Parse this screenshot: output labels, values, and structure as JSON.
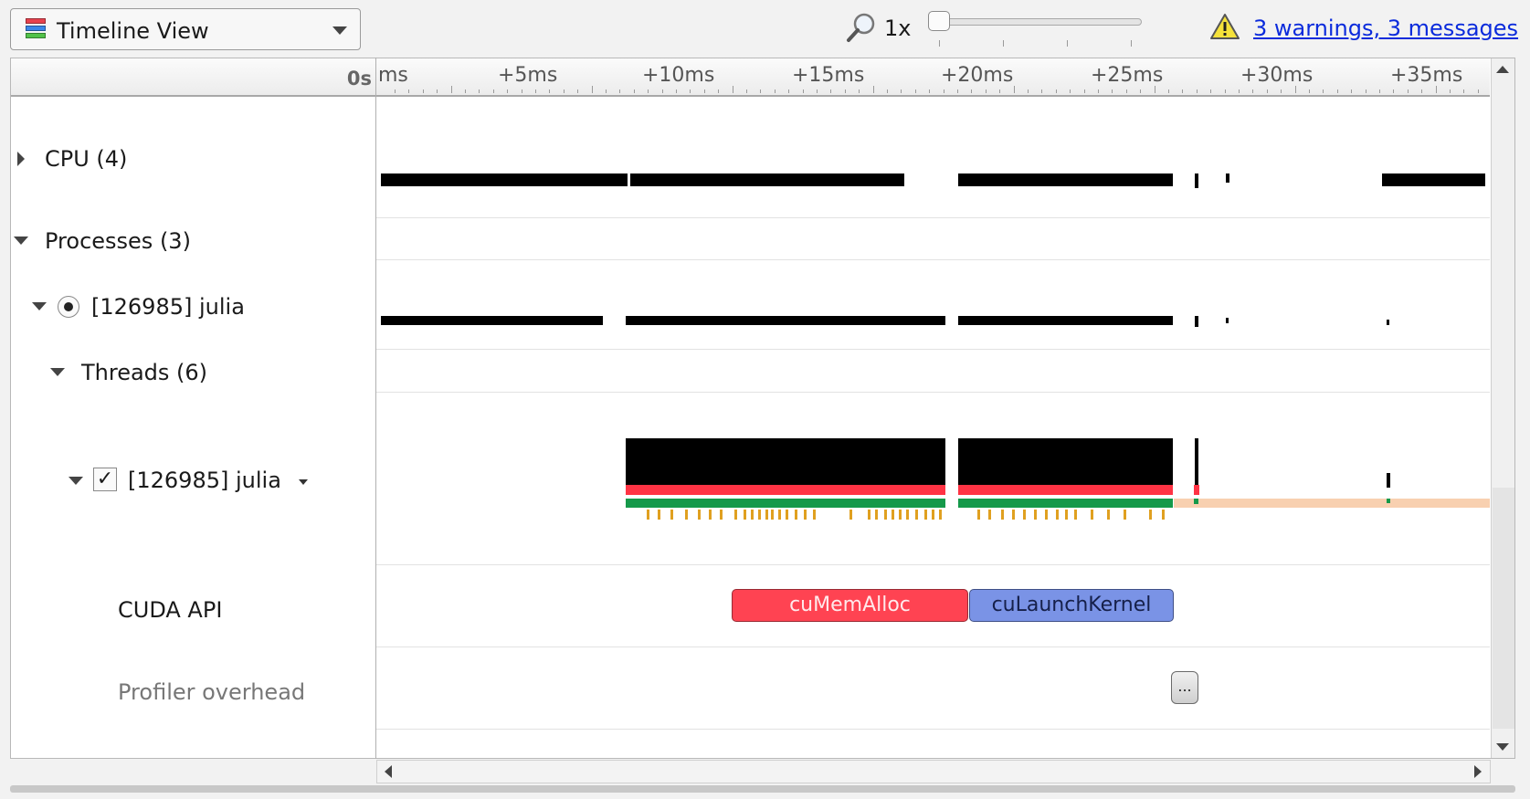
{
  "toolbar": {
    "view_label": "Timeline View",
    "zoom_label": "1x",
    "warnings_text": "3 warnings, 3 messages"
  },
  "ruler": {
    "zero_label": "0s",
    "labels": [
      "ms",
      "+5ms",
      "+10ms",
      "+15ms",
      "+20ms",
      "+25ms",
      "+30ms",
      "+35ms"
    ]
  },
  "tree": {
    "cpu": "CPU (4)",
    "processes": "Processes (3)",
    "process": "[126985] julia",
    "threads": "Threads (6)",
    "thread": "[126985] julia",
    "cuda_api": "CUDA API",
    "profiler_overhead": "Profiler overhead"
  },
  "events": {
    "cu_mem_alloc": "cuMemAlloc",
    "cu_launch_kernel": "cuLaunchKernel",
    "overhead_more": "..."
  },
  "thread_state": {
    "checked_mark": "✓"
  },
  "colors": {
    "activity": "#000000",
    "thread_running": "#ff3344",
    "thread_green": "#15994a",
    "thread_idle": "#f8d0b0",
    "os_marker": "#e0a020",
    "api_red": "#ff4352",
    "api_blue": "#7a93e6",
    "link": "#0b2bdc"
  }
}
